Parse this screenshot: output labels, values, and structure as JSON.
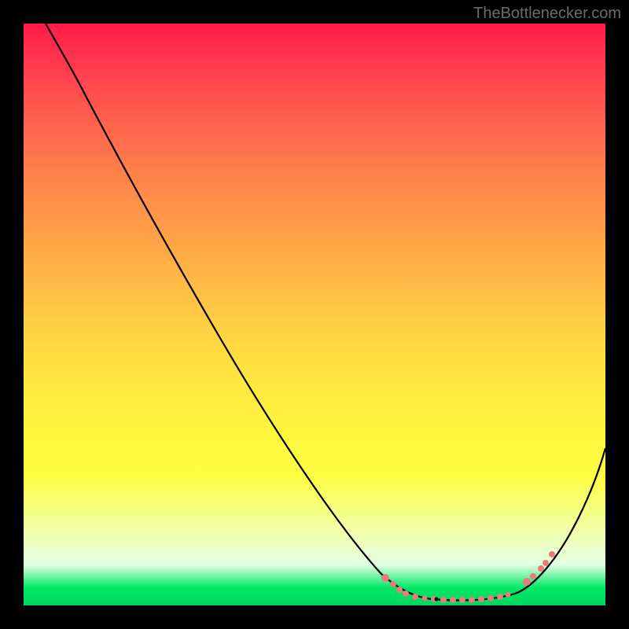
{
  "watermark": "TheBottlenecker.com",
  "chart_data": {
    "type": "line",
    "title": "",
    "xlabel": "",
    "ylabel": "",
    "xlim": [
      0,
      100
    ],
    "ylim": [
      0,
      100
    ],
    "description": "Bottleneck curve: y-axis represents mismatch (high=red at top, low=green at bottom). Curve descends from upper-left to a minimum basin around x≈68–84 then rises to the right.",
    "series": [
      {
        "name": "bottleneck-curve",
        "x": [
          4,
          8,
          12,
          16,
          20,
          24,
          28,
          32,
          36,
          40,
          44,
          48,
          52,
          56,
          60,
          64,
          68,
          72,
          76,
          80,
          84,
          88,
          92,
          96,
          100
        ],
        "y": [
          100,
          97,
          92,
          86,
          79,
          72,
          65,
          58,
          51,
          44,
          37,
          30,
          24,
          18,
          13,
          8,
          4,
          2,
          1.5,
          1.5,
          2,
          5,
          10,
          17,
          25
        ]
      }
    ],
    "markers": {
      "description": "Pink dotted segment along the basin indicating recommended range",
      "x_range": [
        62,
        88
      ],
      "color": "#f08080"
    },
    "background_gradient": {
      "type": "vertical",
      "stops": [
        {
          "pos": 0.0,
          "color": "#ff1a4a"
        },
        {
          "pos": 0.5,
          "color": "#ffd242"
        },
        {
          "pos": 0.8,
          "color": "#fdff44"
        },
        {
          "pos": 0.97,
          "color": "#00e865"
        },
        {
          "pos": 1.0,
          "color": "#00d860"
        }
      ]
    }
  }
}
